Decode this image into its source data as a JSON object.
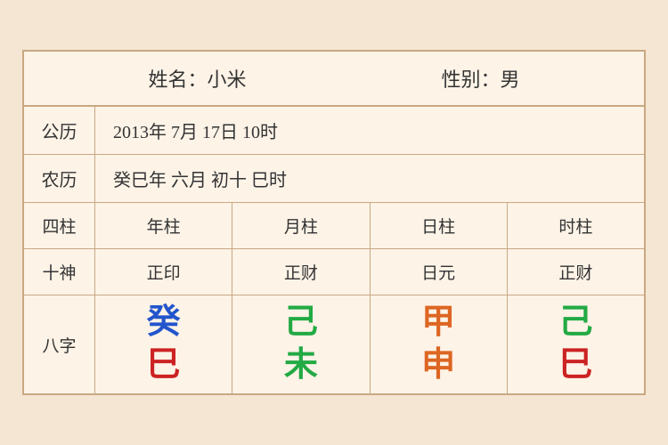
{
  "header": {
    "name_label": "姓名：小米",
    "gender_label": "性别：男"
  },
  "solar": {
    "label": "公历",
    "value": "2013年 7月 17日 10时"
  },
  "lunar": {
    "label": "农历",
    "value": "癸巳年 六月 初十 巳时"
  },
  "columns": {
    "header_label": "四柱",
    "year": "年柱",
    "month": "月柱",
    "day": "日柱",
    "hour": "时柱"
  },
  "shishen": {
    "label": "十神",
    "year": "正印",
    "month": "正财",
    "day": "日元",
    "hour": "正财"
  },
  "bazi": {
    "label": "八字",
    "year_top": "癸",
    "year_bottom": "巳",
    "month_top": "己",
    "month_bottom": "未",
    "day_top": "甲",
    "day_bottom": "申",
    "hour_top": "己",
    "hour_bottom": "巳"
  }
}
